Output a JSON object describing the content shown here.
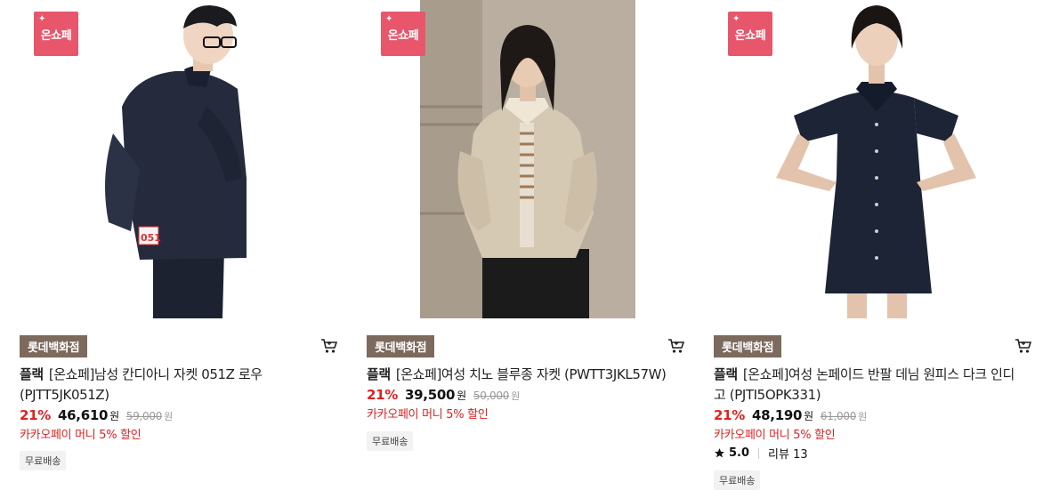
{
  "products": [
    {
      "badge": "온쇼페",
      "store": "롯데백화점",
      "brand": "플랙",
      "name": "[온쇼페]남성 칸디아니 자켓 051Z 로우 (PJTT5JK051Z)",
      "discount": "21%",
      "price": "46,610",
      "currency": "원",
      "original_price": "59,000",
      "original_currency": "원",
      "promo": "카카오페이 머니 5% 할인",
      "shipping": "무료배송",
      "image_label": "051"
    },
    {
      "badge": "온쇼페",
      "store": "롯데백화점",
      "brand": "플랙",
      "name": "[온쇼페]여성 치노 블루종 자켓 (PWTT3JKL57W)",
      "discount": "21%",
      "price": "39,500",
      "currency": "원",
      "original_price": "50,000",
      "original_currency": "원",
      "promo": "카카오페이 머니 5% 할인",
      "shipping": "무료배송"
    },
    {
      "badge": "온쇼페",
      "store": "롯데백화점",
      "brand": "플랙",
      "name": "[온쇼페]여성 논페이드 반팔 데님 원피스 다크 인디고 (PJTI5OPK331)",
      "discount": "21%",
      "price": "48,190",
      "currency": "원",
      "original_price": "61,000",
      "original_currency": "원",
      "promo": "카카오페이 머니 5% 할인",
      "rating": "5.0",
      "review_label": "리뷰 13",
      "shipping": "무료배송"
    }
  ],
  "icons": {
    "cart": "cart-icon",
    "star": "star-icon",
    "sparkle": "sparkle-icon"
  },
  "colors": {
    "badge": "#e8566c",
    "store_tag": "#7c6a5d",
    "discount": "#e02020",
    "promo": "#e02020"
  }
}
